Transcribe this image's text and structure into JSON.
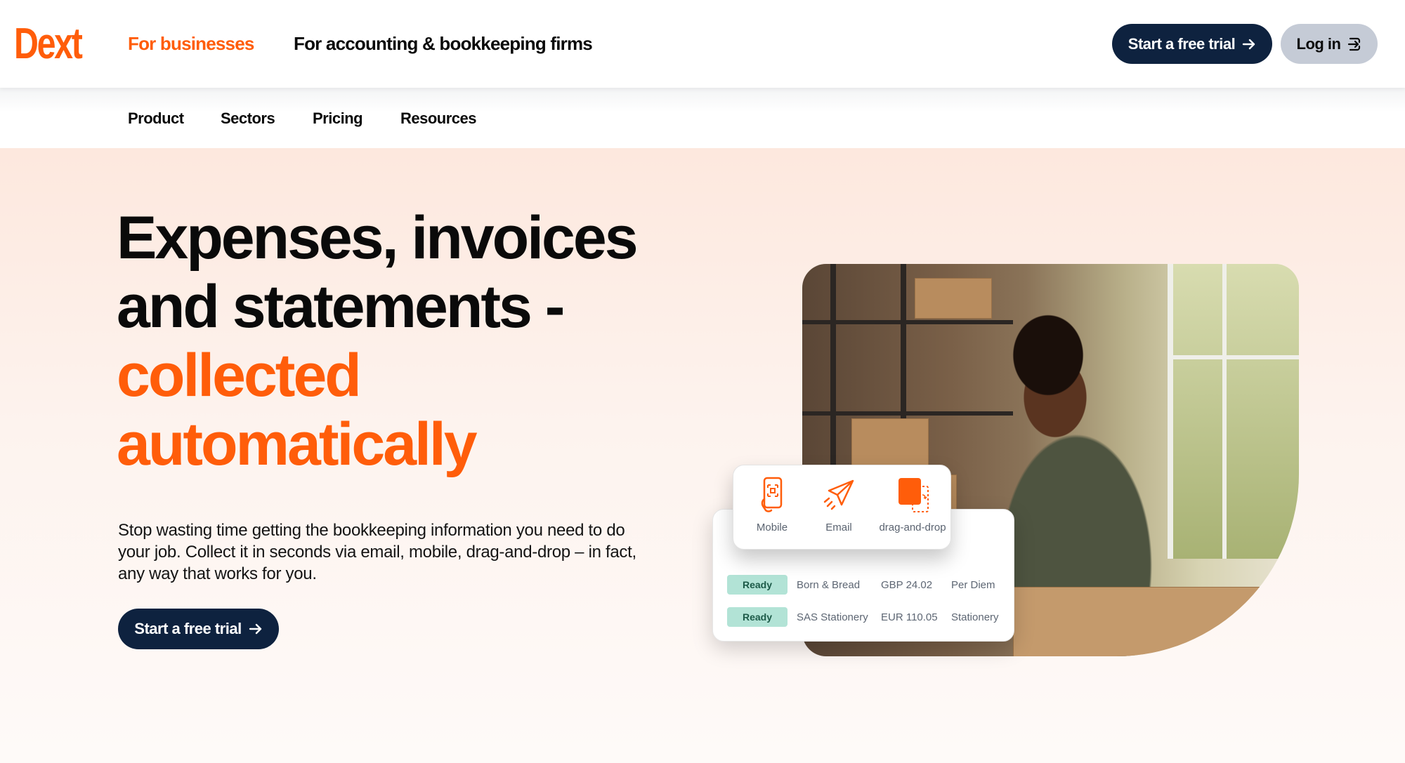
{
  "header": {
    "logo": "Dext",
    "audiences": [
      {
        "label": "For businesses",
        "active": true
      },
      {
        "label": "For accounting & bookkeeping firms",
        "active": false
      }
    ],
    "cta_label": "Start a free trial",
    "cta_icon": "arrow-right-icon",
    "login_label": "Log in",
    "login_icon": "login-icon"
  },
  "subnav": {
    "items": [
      "Product",
      "Sectors",
      "Pricing",
      "Resources"
    ]
  },
  "hero": {
    "headline_line1": "Expenses, invoices",
    "headline_line2": "and statements -",
    "headline_line3": "collected",
    "headline_line4": "automatically",
    "lead": "Stop wasting time getting the bookkeeping information you need to do your job. Collect it in seconds via email, mobile, drag-and-drop – in fact, any way that works for you.",
    "cta_label": "Start a free trial",
    "cta_icon": "arrow-right-icon"
  },
  "capture_card": {
    "methods": [
      {
        "label": "Mobile",
        "icon": "mobile-scan-icon"
      },
      {
        "label": "Email",
        "icon": "paper-plane-icon"
      },
      {
        "label": "drag-and-drop",
        "icon": "drag-drop-icon"
      }
    ]
  },
  "documents": {
    "rows": [
      {
        "status": "Ready",
        "vendor": "Born & Bread",
        "amount": "GBP 24.02",
        "category": "Per Diem"
      },
      {
        "status": "Ready",
        "vendor": "SAS Stationery",
        "amount": "EUR 110.05",
        "category": "Stationery"
      }
    ]
  },
  "colors": {
    "brand_orange": "#ff5d0a",
    "navy": "#0e223f",
    "login_bg": "#c5cbd6",
    "ready_badge": "#b2e3d6"
  }
}
